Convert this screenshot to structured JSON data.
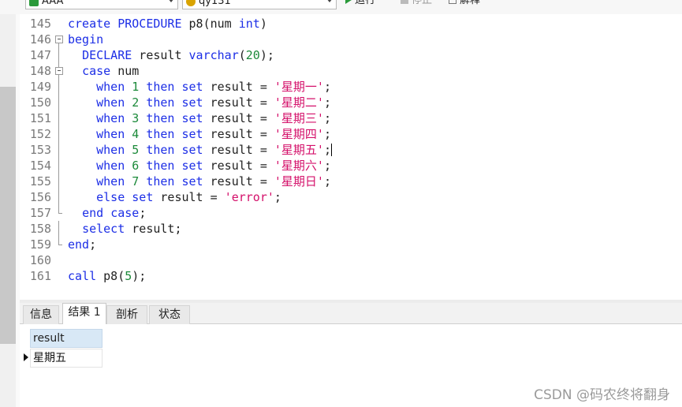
{
  "toolbar": {
    "connection_select": "AAA",
    "database_select": "qy131",
    "run_label": "运行",
    "stop_label": "停止",
    "explain_label": "解释"
  },
  "editor": {
    "lines": [
      {
        "no": "145",
        "fold": "none",
        "html": "<span class=\"kw\">create</span> <span class=\"kw\">PROCEDURE</span> p8(num <span class=\"kw\">int</span>)"
      },
      {
        "no": "146",
        "fold": "open",
        "html": "<span class=\"kw\">begin</span>"
      },
      {
        "no": "147",
        "fold": "line",
        "html": "  <span class=\"kw\">DECLARE</span> result <span class=\"kw\">varchar</span>(<span class=\"num\">20</span>);"
      },
      {
        "no": "148",
        "fold": "open2",
        "html": "  <span class=\"kw\">case</span> num"
      },
      {
        "no": "149",
        "fold": "line",
        "html": "    <span class=\"kw\">when</span> <span class=\"num\">1</span> <span class=\"kw\">then</span> <span class=\"kw\">set</span> result = <span class=\"str\">'星期一'</span>;"
      },
      {
        "no": "150",
        "fold": "line",
        "html": "    <span class=\"kw\">when</span> <span class=\"num\">2</span> <span class=\"kw\">then</span> <span class=\"kw\">set</span> result = <span class=\"str\">'星期二'</span>;"
      },
      {
        "no": "151",
        "fold": "line",
        "html": "    <span class=\"kw\">when</span> <span class=\"num\">3</span> <span class=\"kw\">then</span> <span class=\"kw\">set</span> result = <span class=\"str\">'星期三'</span>;"
      },
      {
        "no": "152",
        "fold": "line",
        "html": "    <span class=\"kw\">when</span> <span class=\"num\">4</span> <span class=\"kw\">then</span> <span class=\"kw\">set</span> result = <span class=\"str\">'星期四'</span>;"
      },
      {
        "no": "153",
        "fold": "line",
        "html": "    <span class=\"kw\">when</span> <span class=\"num\">5</span> <span class=\"kw\">then</span> <span class=\"kw\">set</span> result = <span class=\"str\">'星期五'</span>;<span class=\"caret\"></span>"
      },
      {
        "no": "154",
        "fold": "line",
        "html": "    <span class=\"kw\">when</span> <span class=\"num\">6</span> <span class=\"kw\">then</span> <span class=\"kw\">set</span> result = <span class=\"str\">'星期六'</span>;"
      },
      {
        "no": "155",
        "fold": "line",
        "html": "    <span class=\"kw\">when</span> <span class=\"num\">7</span> <span class=\"kw\">then</span> <span class=\"kw\">set</span> result = <span class=\"str\">'星期日'</span>;"
      },
      {
        "no": "156",
        "fold": "line",
        "html": "    <span class=\"kw\">else</span> <span class=\"kw\">set</span> result = <span class=\"str\">'error'</span>;"
      },
      {
        "no": "157",
        "fold": "end",
        "html": "  <span class=\"kw\">end</span> <span class=\"kw\">case</span>;"
      },
      {
        "no": "158",
        "fold": "line",
        "html": "  <span class=\"kw\">select</span> result;"
      },
      {
        "no": "159",
        "fold": "end",
        "html": "<span class=\"kw\">end</span>;"
      },
      {
        "no": "160",
        "fold": "none",
        "html": ""
      },
      {
        "no": "161",
        "fold": "none",
        "html": "<span class=\"kw\">call</span> p8(<span class=\"num\">5</span>);"
      }
    ]
  },
  "tabs": [
    {
      "label": "信息",
      "active": false
    },
    {
      "label": "结果 1",
      "active": true
    },
    {
      "label": "剖析",
      "active": false
    },
    {
      "label": "状态",
      "active": false
    }
  ],
  "result": {
    "column": "result",
    "value": "星期五"
  },
  "watermark": "CSDN @码农终将翻身"
}
